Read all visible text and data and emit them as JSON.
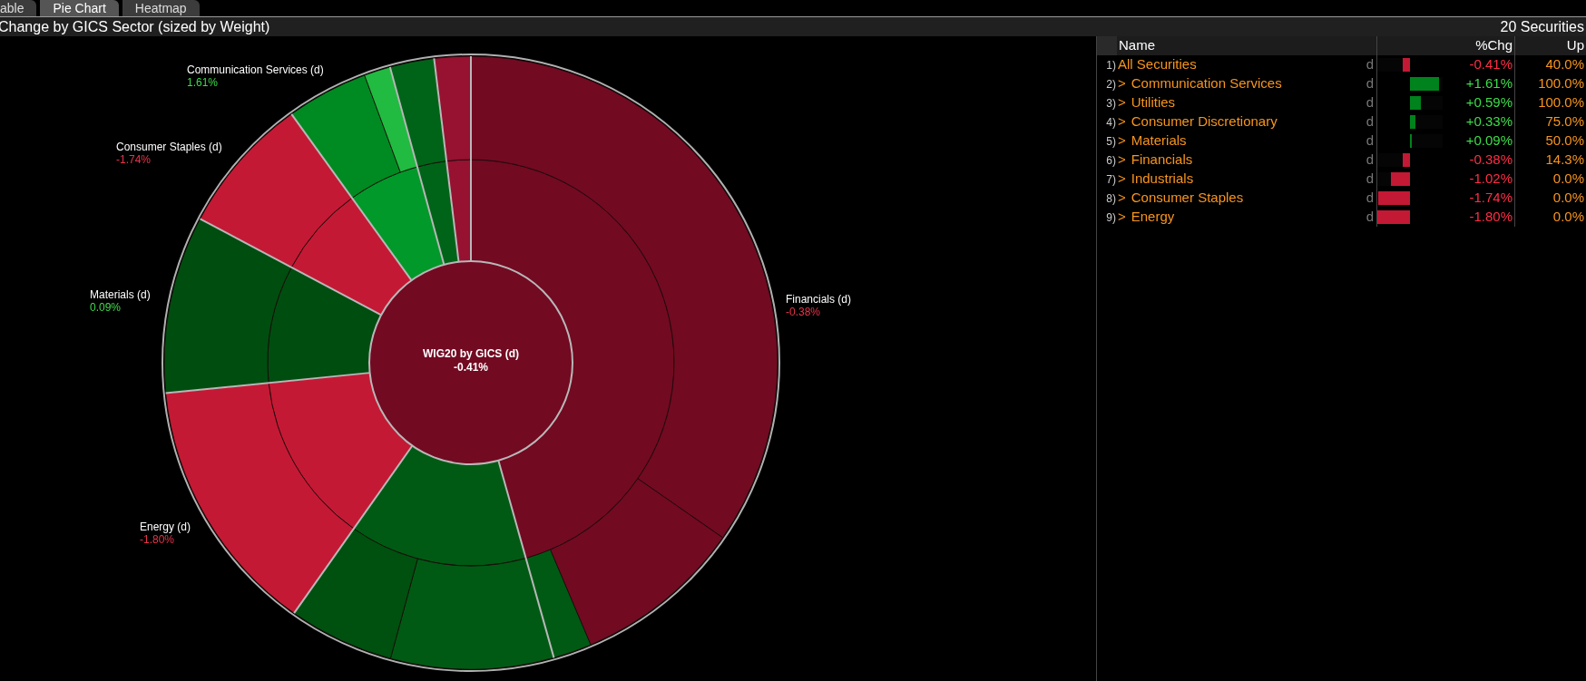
{
  "tabs": [
    {
      "label": "able",
      "selected": false
    },
    {
      "label": "Pie Chart",
      "selected": true
    },
    {
      "label": "Heatmap",
      "selected": false
    }
  ],
  "title_bar": {
    "title": "Change by GICS Sector (sized by Weight)",
    "count": "20 Securities"
  },
  "chart": {
    "center_title": "WIG20 by GICS (d)",
    "center_value": "-0.41%",
    "labels": [
      {
        "name": "Communication Services (d)",
        "change": "1.61%",
        "positive": true
      },
      {
        "name": "Consumer Staples (d)",
        "change": "-1.74%",
        "positive": false
      },
      {
        "name": "Materials (d)",
        "change": "0.09%",
        "positive": true
      },
      {
        "name": "Energy (d)",
        "change": "-1.80%",
        "positive": false
      },
      {
        "name": "Financials (d)",
        "change": "-0.38%",
        "positive": false
      }
    ]
  },
  "table": {
    "columns": [
      "Name",
      "%Chg",
      "Up"
    ],
    "rows": [
      {
        "number": "1)",
        "name": "All Securities",
        "flag": "d",
        "change": "-0.41%",
        "positive": false,
        "level": 0.23,
        "up": "40.0%"
      },
      {
        "number": "2)",
        "expander": ">",
        "name": "Communication Services",
        "flag": "d",
        "change": "+1.61%",
        "positive": true,
        "level": 0.89,
        "up": "100.0%"
      },
      {
        "number": "3)",
        "expander": ">",
        "name": "Utilities",
        "flag": "d",
        "change": "+0.59%",
        "positive": true,
        "level": 0.33,
        "up": "100.0%"
      },
      {
        "number": "4)",
        "expander": ">",
        "name": "Consumer Discretionary",
        "flag": "d",
        "change": "+0.33%",
        "positive": true,
        "level": 0.18,
        "up": "75.0%"
      },
      {
        "number": "5)",
        "expander": ">",
        "name": "Materials",
        "flag": "d",
        "change": "+0.09%",
        "positive": true,
        "level": 0.05,
        "up": "50.0%"
      },
      {
        "number": "6)",
        "expander": ">",
        "name": "Financials",
        "flag": "d",
        "change": "-0.38%",
        "positive": false,
        "level": 0.21,
        "up": "14.3%"
      },
      {
        "number": "7)",
        "expander": ">",
        "name": "Industrials",
        "flag": "d",
        "change": "-1.02%",
        "positive": false,
        "level": 0.57,
        "up": "0.0%"
      },
      {
        "number": "8)",
        "expander": ">",
        "name": "Consumer Staples",
        "flag": "d",
        "change": "-1.74%",
        "positive": false,
        "level": 0.97,
        "up": "0.0%"
      },
      {
        "number": "9)",
        "expander": ">",
        "name": "Energy",
        "flag": "d",
        "change": "-1.80%",
        "positive": false,
        "level": 1.0,
        "up": "0.0%"
      }
    ]
  }
}
